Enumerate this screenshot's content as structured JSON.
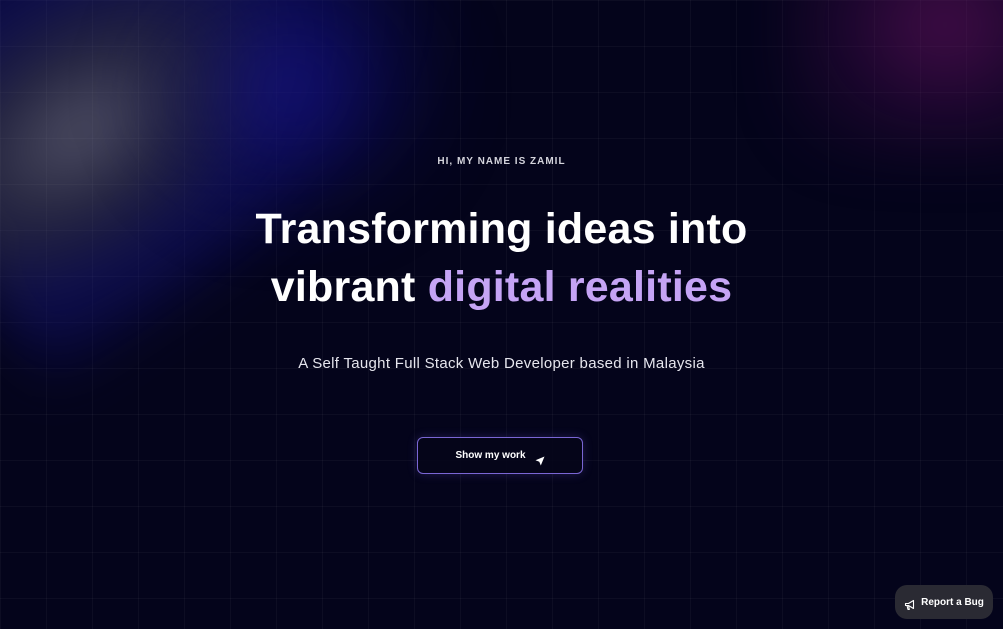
{
  "hero": {
    "eyebrow": "HI, MY NAME IS ZAMIL",
    "headline_line1": "Transforming ideas into",
    "headline_line2_plain": "vibrant ",
    "headline_line2_accent": "digital realities",
    "subtitle": "A Self Taught Full Stack Web Developer based in Malaysia"
  },
  "cta": {
    "label": "Show my work",
    "icon": "send-arrow-icon"
  },
  "report_bug": {
    "label": "Report a Bug",
    "icon": "megaphone-icon"
  },
  "colors": {
    "background": "#04041b",
    "accent": "#c5a4f5",
    "button_border": "#7a66d4",
    "bug_button_bg": "#2a2a33"
  }
}
